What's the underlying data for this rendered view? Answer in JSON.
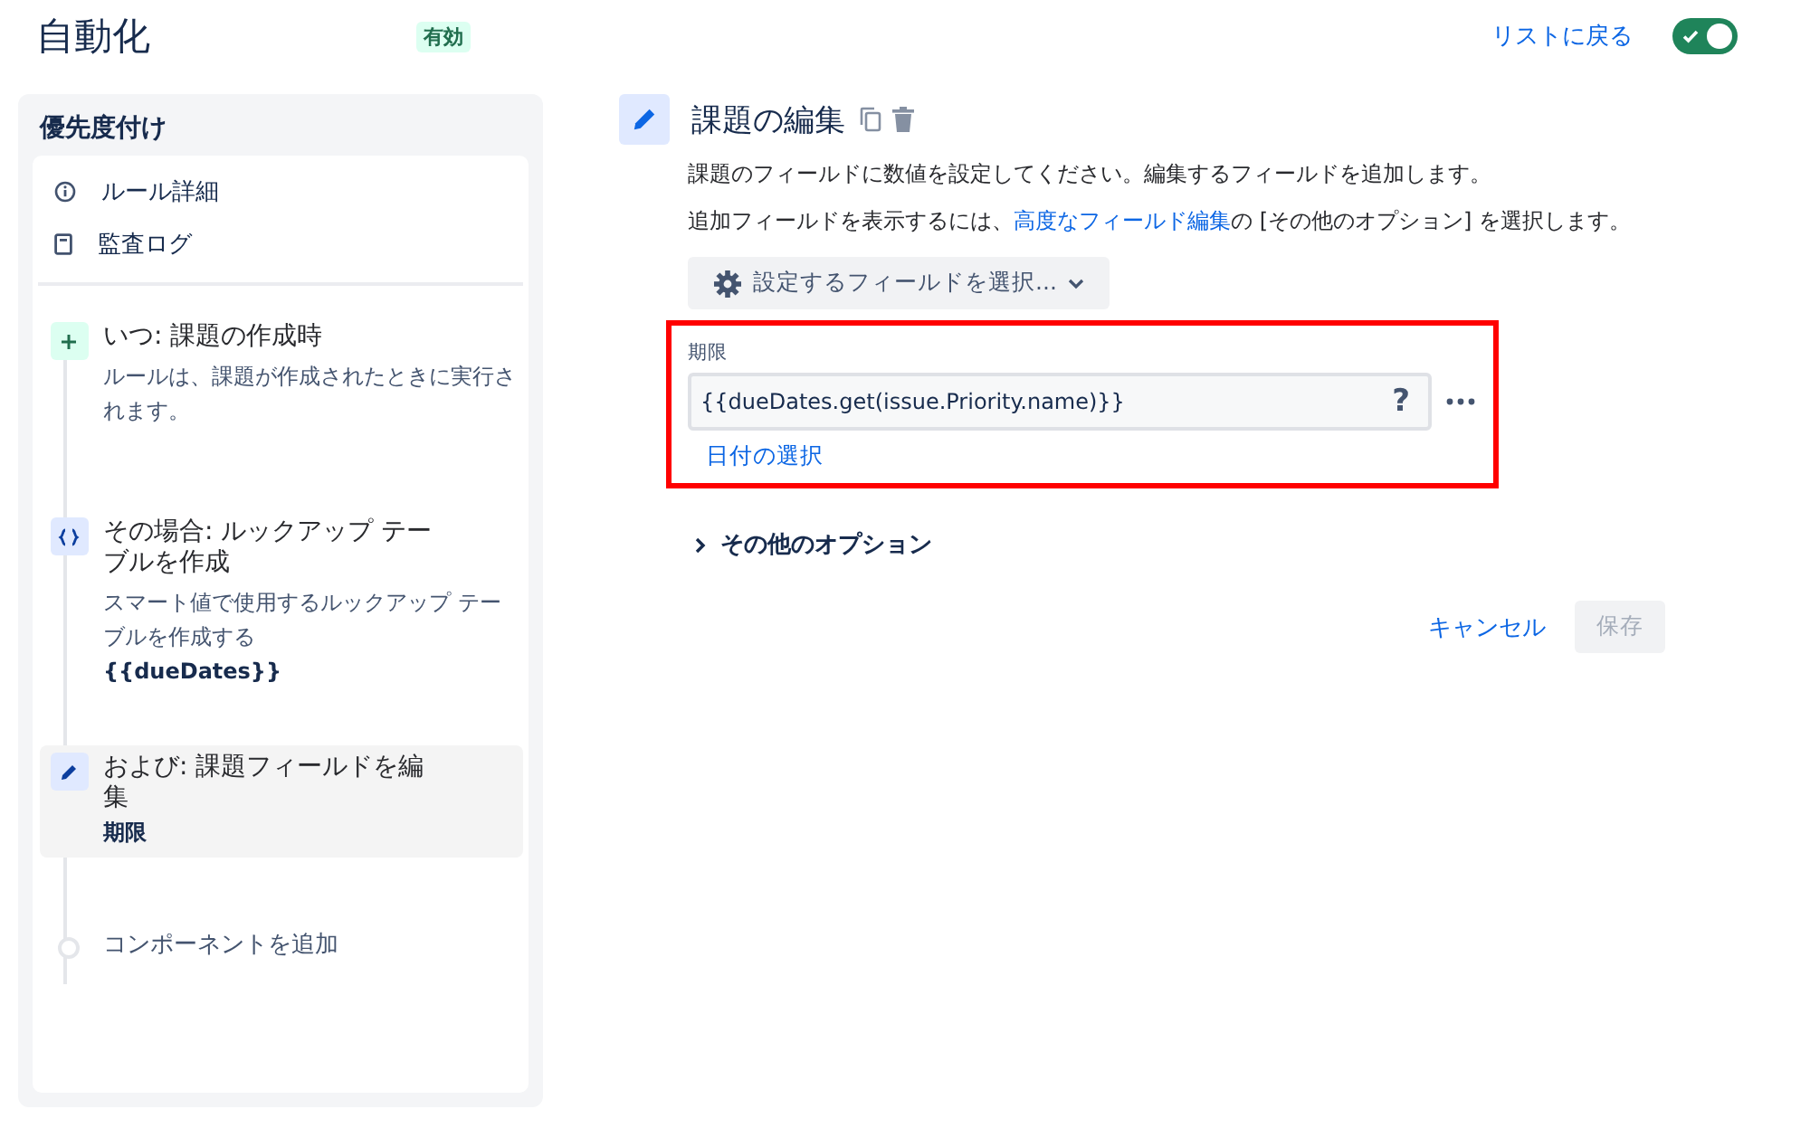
{
  "header": {
    "title": "自動化",
    "status_badge": "有効",
    "back_link": "リストに戻る",
    "toggle": {
      "on": true
    }
  },
  "sidebar": {
    "title": "優先度付け",
    "menu": [
      {
        "kind": "info",
        "label": "ルール詳細"
      },
      {
        "kind": "log",
        "label": "監査ログ"
      }
    ],
    "steps": [
      {
        "kind": "trigger",
        "title": "いつ: 課題の作成時",
        "description": "ルールは、課題が作成されたときに実行されます。",
        "selected": false
      },
      {
        "kind": "condition",
        "title": "その場合: ルックアップ テーブルを作成",
        "description": "スマート値で使用するルックアップ テーブルを作成する",
        "detail": "{{dueDates}}",
        "selected": false
      },
      {
        "kind": "action",
        "title": "および: 課題フィールドを編集",
        "detail": "期限",
        "selected": true
      },
      {
        "kind": "add",
        "title": "コンポーネントを追加",
        "selected": false
      }
    ]
  },
  "editor": {
    "title": "課題の編集",
    "description": "課題のフィールドに数値を設定してください。編集するフィールドを追加します。",
    "hint": {
      "before": "追加フィールドを表示するには、",
      "link": "高度なフィールド編集",
      "after": "の [その他のオプション] を選択します。"
    },
    "field_picker": "設定するフィールドを選択...",
    "field": {
      "label": "期限",
      "value": "{{dueDates.get(issue.Priority.name)}}",
      "help": "?",
      "date_link": "日付の選択"
    },
    "more_options": {
      "label": "その他のオプション",
      "expanded": false
    },
    "cancel": "キャンセル",
    "save": {
      "label": "保存",
      "disabled": true
    }
  }
}
